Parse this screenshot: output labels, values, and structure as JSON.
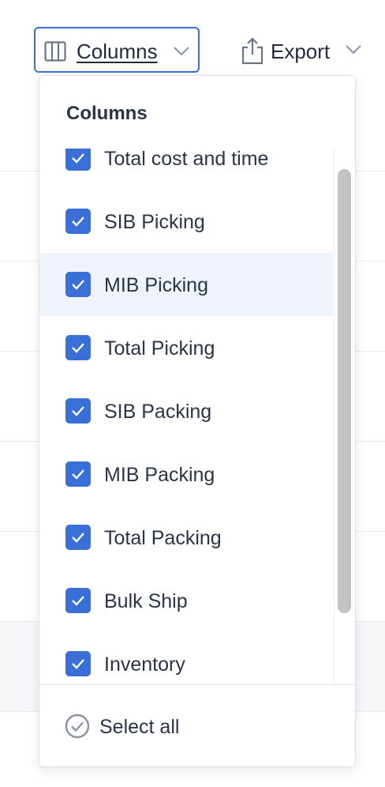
{
  "toolbar": {
    "columns_label": "Columns",
    "columns_icon": "columns-icon",
    "export_label": "Export",
    "export_icon": "share-icon",
    "accent_color": "#3b6fd8"
  },
  "columns_popover": {
    "title": "Columns",
    "items": [
      {
        "label": "Total cost and time",
        "checked": true
      },
      {
        "label": "SIB Picking",
        "checked": true
      },
      {
        "label": "MIB Picking",
        "checked": true
      },
      {
        "label": "Total Picking",
        "checked": true
      },
      {
        "label": "SIB Packing",
        "checked": true
      },
      {
        "label": "MIB Packing",
        "checked": true
      },
      {
        "label": "Total Packing",
        "checked": true
      },
      {
        "label": "Bulk Ship",
        "checked": true
      },
      {
        "label": "Inventory",
        "checked": true
      }
    ],
    "select_all_label": "Select all",
    "select_all_icon": "circle-check-icon"
  }
}
